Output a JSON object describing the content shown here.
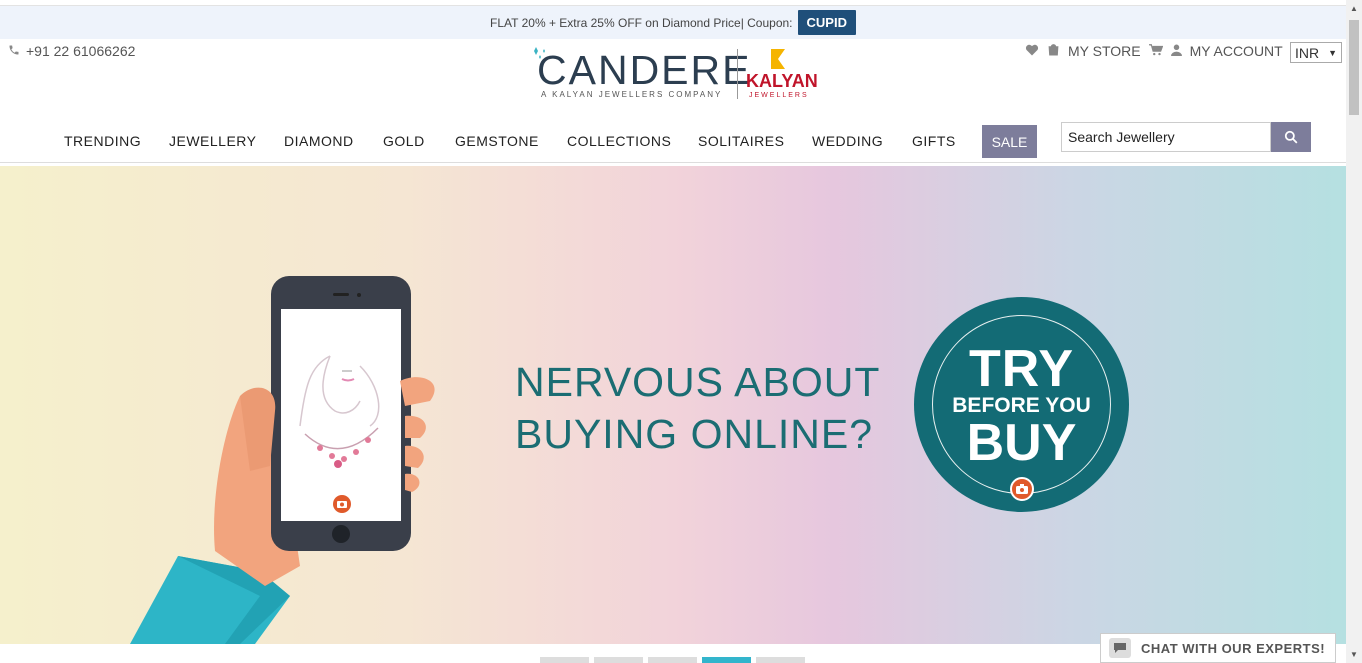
{
  "promo": {
    "text": "FLAT 20% + Extra 25% OFF on Diamond Price| Coupon:",
    "coupon": "CUPID"
  },
  "header": {
    "phone": "+91 22 61066262",
    "logo": {
      "brand": "CANDERE",
      "tagline": "A KALYAN JEWELLERS COMPANY",
      "partner": "KALYAN",
      "partner_sub": "JEWELLERS"
    },
    "my_store": "MY STORE",
    "my_account": "MY ACCOUNT",
    "currency": "INR"
  },
  "nav": {
    "items": [
      "TRENDING",
      "JEWELLERY",
      "DIAMOND",
      "GOLD",
      "GEMSTONE",
      "COLLECTIONS",
      "SOLITAIRES",
      "WEDDING",
      "GIFTS"
    ],
    "sale": "SALE"
  },
  "search": {
    "placeholder": "Search Jewellery"
  },
  "banner": {
    "headline_line1": "NERVOUS ABOUT",
    "headline_line2": "BUYING ONLINE?",
    "badge_line1": "TRY",
    "badge_line2": "BEFORE YOU",
    "badge_line3": "BUY",
    "active_slide": 4,
    "slide_count": 5
  },
  "chat": {
    "label": "CHAT WITH OUR EXPERTS!"
  },
  "colors": {
    "accent": "#136b75",
    "sale": "#7d7d9b",
    "coupon": "#1f4f7a",
    "brand_red": "#c0142a"
  }
}
